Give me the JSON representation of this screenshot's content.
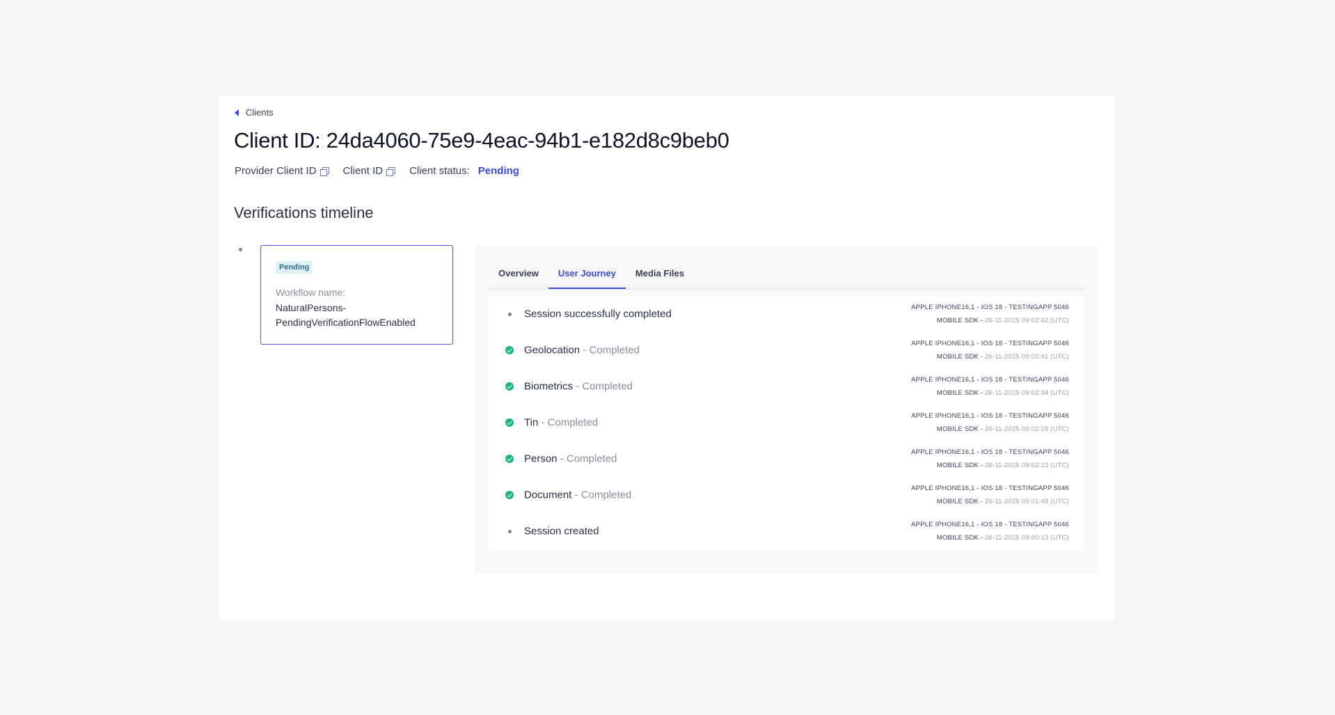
{
  "back_link": {
    "label": "Clients"
  },
  "page_title": "Client ID: 24da4060-75e9-4eac-94b1-e182d8c9beb0",
  "meta": {
    "provider_client_id_label": "Provider Client ID",
    "client_id_label": "Client ID",
    "client_status_label": "Client status:",
    "client_status_value": "Pending"
  },
  "section_title": "Verifications timeline",
  "workflow_card": {
    "badge": "Pending",
    "label": "Workflow name:",
    "name": "NaturalPersons-PendingVerificationFlowEnabled"
  },
  "tabs": [
    {
      "label": "Overview"
    },
    {
      "label": "User Journey"
    },
    {
      "label": "Media Files"
    }
  ],
  "journey": [
    {
      "icon": "bullet-icon",
      "name": "Session successfully completed",
      "state": "",
      "device": "APPLE IPHONE16,1 - IOS 18 - TESTINGAPP 5046",
      "sdk": "MOBILE SDK - ",
      "timestamp": "26-11-2025 09:02:42 (UTC)"
    },
    {
      "icon": "check-circle-icon",
      "name": "Geolocation",
      "state": " - Completed",
      "device": "APPLE IPHONE16,1 - IOS 18 - TESTINGAPP 5046",
      "sdk": "MOBILE SDK - ",
      "timestamp": "26-11-2025 09:02:41 (UTC)"
    },
    {
      "icon": "check-circle-icon",
      "name": "Biometrics",
      "state": " - Completed",
      "device": "APPLE IPHONE16,1 - IOS 18 - TESTINGAPP 5046",
      "sdk": "MOBILE SDK - ",
      "timestamp": "26-11-2025 09:02:34 (UTC)"
    },
    {
      "icon": "check-circle-icon",
      "name": "Tin",
      "state": " - Completed",
      "device": "APPLE IPHONE16,1 - IOS 18 - TESTINGAPP 5046",
      "sdk": "MOBILE SDK - ",
      "timestamp": "26-11-2025 09:02:18 (UTC)"
    },
    {
      "icon": "check-circle-icon",
      "name": "Person",
      "state": " - Completed",
      "device": "APPLE IPHONE16,1 - IOS 18 - TESTINGAPP 5046",
      "sdk": "MOBILE SDK - ",
      "timestamp": "26-11-2025 09:02:13 (UTC)"
    },
    {
      "icon": "check-circle-icon",
      "name": "Document",
      "state": " - Completed",
      "device": "APPLE IPHONE16,1 - IOS 18 - TESTINGAPP 5046",
      "sdk": "MOBILE SDK - ",
      "timestamp": "26-11-2025 09:01:48 (UTC)"
    },
    {
      "icon": "bullet-icon",
      "name": "Session created",
      "state": "",
      "device": "APPLE IPHONE16,1 - IOS 18 - TESTINGAPP 5046",
      "sdk": "MOBILE SDK - ",
      "timestamp": "26-11-2025 09:00:13 (UTC)"
    }
  ],
  "colors": {
    "accent": "#3b4bd6",
    "success": "#16b877",
    "badge_bg": "#dff0f7"
  }
}
